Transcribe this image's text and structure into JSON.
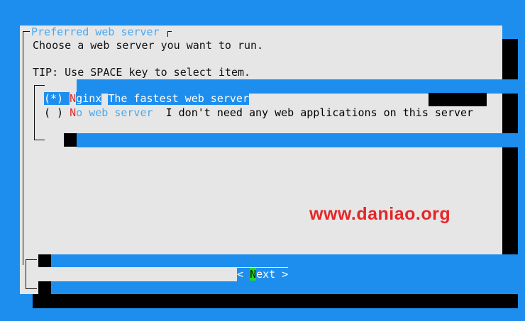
{
  "dialog": {
    "title": "Preferred web server",
    "description": "Choose a web server you want to run.",
    "tip": "TIP: Use SPACE key to select item."
  },
  "list": {
    "items": [
      {
        "marker": "(*)",
        "key": "N",
        "name_rest": "ginx",
        "description": "The fastest web server",
        "selected": true
      },
      {
        "marker": "( )",
        "key": "N",
        "name_rest": "o web server",
        "description": "I don't need any web applications on this server",
        "selected": false
      }
    ]
  },
  "buttons": {
    "next_open": "< ",
    "next_key": "N",
    "next_rest": "ext",
    "next_close": " >"
  },
  "watermark": "www.daniao.org",
  "colors": {
    "background": "#1e8eee",
    "dialog": "#e6e6e6",
    "hotkey": "#e03030",
    "watermark": "#e52626",
    "button_hotkey_bg": "#22d822"
  }
}
